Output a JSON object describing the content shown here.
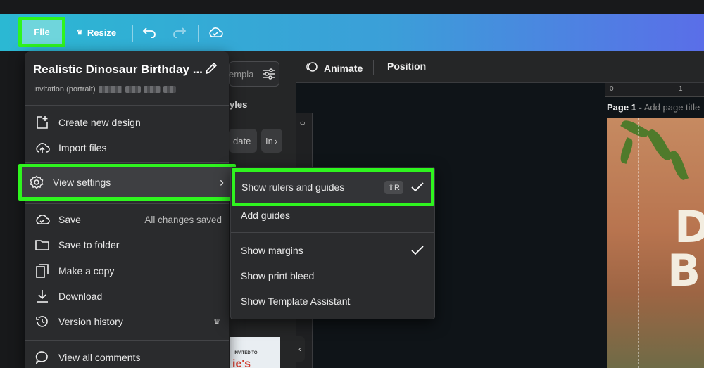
{
  "topbar": {
    "file_label": "File",
    "resize_label": "Resize"
  },
  "editor": {
    "search_placeholder": "empla",
    "styles_label": "yles",
    "chips": [
      "date",
      "In"
    ],
    "animate_label": "Animate",
    "position_label": "Position",
    "ruler_ticks": [
      "0",
      "1"
    ],
    "left_ruler_tick": "0",
    "page_label": "Page 1 -",
    "page_title_placeholder": "Add page title",
    "thumbnail_text_1": "INVITED TO",
    "thumbnail_text_2": "ie's"
  },
  "file_menu": {
    "design_title": "Realistic Dinosaur Birthday ...",
    "design_type": "Invitation (portrait)",
    "items": [
      {
        "label": "Create new design",
        "icon": "add-file-icon"
      },
      {
        "label": "Import files",
        "icon": "cloud-upload-icon"
      },
      {
        "label": "View settings",
        "icon": "gear-icon"
      },
      {
        "label": "Save",
        "icon": "cloud-check-icon",
        "right": "All changes saved"
      },
      {
        "label": "Save to folder",
        "icon": "folder-icon"
      },
      {
        "label": "Make a copy",
        "icon": "copy-icon"
      },
      {
        "label": "Download",
        "icon": "download-icon"
      },
      {
        "label": "Version history",
        "icon": "history-icon"
      },
      {
        "label": "View all comments",
        "icon": "comment-icon"
      }
    ]
  },
  "view_settings_menu": {
    "items": [
      {
        "label": "Show rulers and guides",
        "shortcut": "⇧R",
        "checked": true
      },
      {
        "label": "Add guides",
        "checked": false
      },
      {
        "label": "Show margins",
        "checked": true
      },
      {
        "label": "Show print bleed",
        "checked": false
      },
      {
        "label": "Show Template Assistant",
        "checked": false
      }
    ]
  },
  "colors": {
    "highlight": "#2ff51f",
    "topbar_start": "#2bb8d3",
    "topbar_end": "#5a6ee8"
  }
}
